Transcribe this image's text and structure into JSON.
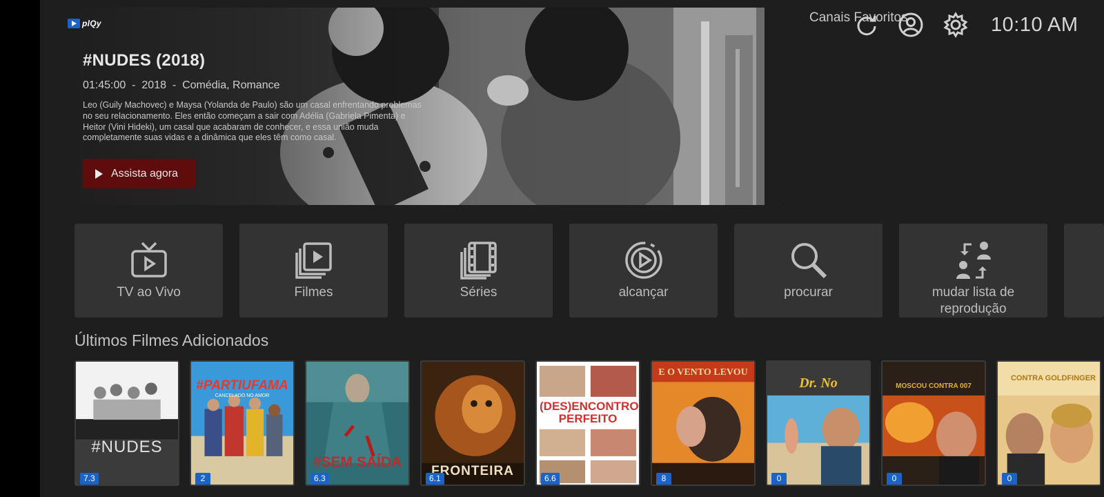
{
  "brand": {
    "name": "plQy",
    "accent": "#1a63c9"
  },
  "hero": {
    "title": "#NUDES (2018)",
    "meta": "01:45:00  -  2018  -  Comédia, Romance",
    "description": "Leo (Guily Machovec) e Maysa (Yolanda de Paulo) são um casal enfrentando problemas no seu relacionamento. Eles então começam a sair com Adélia (Gabriela Pimenta) e Heitor (Vini Hideki), um casal que acabaram de conhecer, e essa união muda completamente suas vidas e a dinâmica que eles têm como casal.",
    "watch_label": "Assista agora",
    "watch_color": "#5e0c0c"
  },
  "topbar": {
    "favorites_label": "Canais Favoritos",
    "icons": [
      "refresh-icon",
      "user-profile-icon",
      "gear-icon"
    ],
    "clock": "10:10 AM"
  },
  "tiles": [
    {
      "id": "tv",
      "label": "TV ao Vivo",
      "icon": "tv-icon"
    },
    {
      "id": "movies",
      "label": "Filmes",
      "icon": "film-play-icon"
    },
    {
      "id": "series",
      "label": "Séries",
      "icon": "film-strip-icon"
    },
    {
      "id": "catchup",
      "label": "alcançar",
      "icon": "replay-icon"
    },
    {
      "id": "search",
      "label": "procurar",
      "icon": "search-icon"
    },
    {
      "id": "switch",
      "label": "mudar lista de reprodução",
      "icon": "switch-users-icon"
    }
  ],
  "section": {
    "title": "Últimos Filmes Adicionados"
  },
  "posters": [
    {
      "title": "#NUDES",
      "rating": "7.3"
    },
    {
      "title": "#PARTIUFAMA",
      "subtitle": "CANCELADO NO AMOR",
      "rating": "2"
    },
    {
      "title": "#SEM SAÍDA",
      "rating": "6.3"
    },
    {
      "title": "FRONTEIRA",
      "rating": "6.1"
    },
    {
      "title": "(DES)ENCONTRO PERFEITO",
      "rating": "6.6"
    },
    {
      "title": "E O VENTO LEVOU",
      "rating": "8"
    },
    {
      "title": "Dr. No",
      "rating": "0"
    },
    {
      "title": "MOSCOU CONTRA 007",
      "rating": "0"
    },
    {
      "title": "CONTRA GOLDFINGER",
      "rating": "0"
    }
  ]
}
